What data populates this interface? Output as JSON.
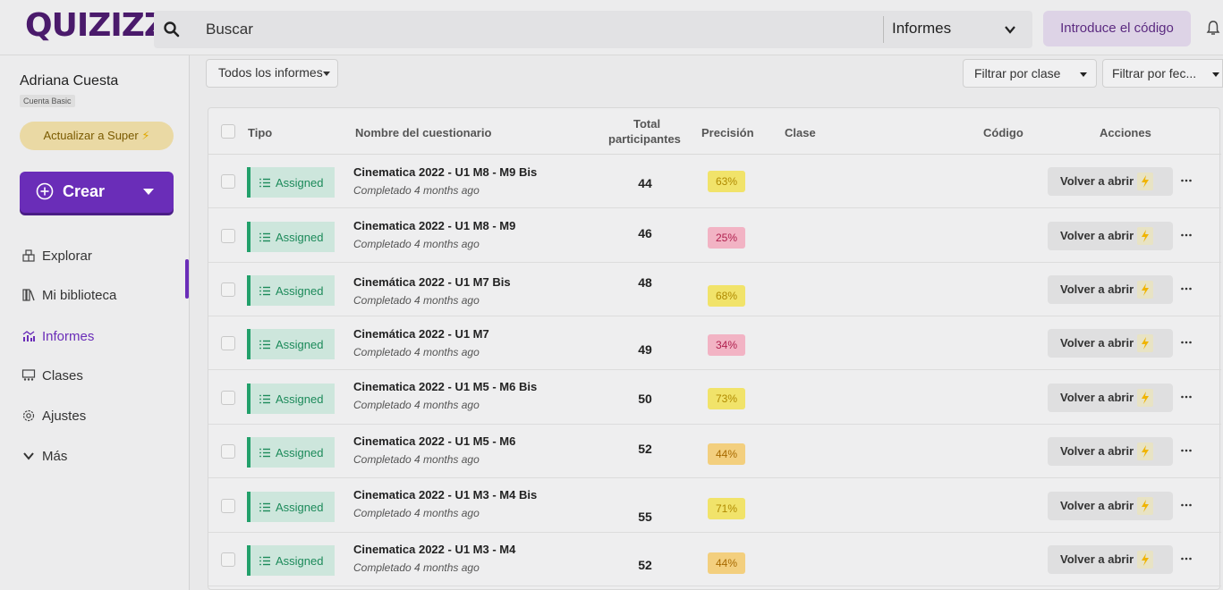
{
  "header": {
    "logo": "QUIZIZZ",
    "search_label": "Buscar",
    "reports_select": "Informes",
    "code_button": "Introduce el código"
  },
  "sidebar": {
    "user_name": "Adriana Cuesta",
    "account_type": "Cuenta Basic",
    "upgrade_label": "Actualizar a Super",
    "create_label": "Crear",
    "items": [
      {
        "label": "Explorar",
        "icon": "explore-icon"
      },
      {
        "label": "Mi biblioteca",
        "icon": "library-icon"
      },
      {
        "label": "Informes",
        "icon": "reports-icon",
        "active": true
      },
      {
        "label": "Clases",
        "icon": "classes-icon"
      },
      {
        "label": "Ajustes",
        "icon": "settings-icon"
      },
      {
        "label": "Más",
        "icon": "chevron-down-icon"
      }
    ]
  },
  "filters": {
    "all_reports": "Todos los informes",
    "by_class": "Filtrar por clase",
    "by_date": "Filtrar por fec..."
  },
  "table": {
    "headers": {
      "type": "Tipo",
      "name": "Nombre del cuestionario",
      "total_line1": "Total",
      "total_line2": "participantes",
      "accuracy": "Precisión",
      "class": "Clase",
      "code": "Código",
      "actions": "Acciones"
    },
    "rows": [
      {
        "type": "Assigned",
        "name": "Cinematica 2022 - U1 M8 - M9 Bis",
        "status": "Completado 4 months ago",
        "participants": "44",
        "accuracy": "63%",
        "level": "yellow"
      },
      {
        "type": "Assigned",
        "name": "Cinematica 2022 - U1 M8 - M9",
        "status": "Completado 4 months ago",
        "participants": "46",
        "accuracy": "25%",
        "level": "red"
      },
      {
        "type": "Assigned",
        "name": "Cinemática 2022 - U1 M7 Bis",
        "status": "Completado 4 months ago",
        "participants": "48",
        "accuracy": "68%",
        "level": "yellow"
      },
      {
        "type": "Assigned",
        "name": "Cinemática 2022 - U1 M7",
        "status": "Completado 4 months ago",
        "participants": "49",
        "accuracy": "34%",
        "level": "red"
      },
      {
        "type": "Assigned",
        "name": "Cinematica 2022 - U1 M5 - M6 Bis",
        "status": "Completado 4 months ago",
        "participants": "50",
        "accuracy": "73%",
        "level": "yellow"
      },
      {
        "type": "Assigned",
        "name": "Cinematica 2022 - U1 M5 - M6",
        "status": "Completado 4 months ago",
        "participants": "52",
        "accuracy": "44%",
        "level": "orange"
      },
      {
        "type": "Assigned",
        "name": "Cinematica 2022 - U1 M3 - M4 Bis",
        "status": "Completado 4 months ago",
        "participants": "55",
        "accuracy": "71%",
        "level": "yellow"
      },
      {
        "type": "Assigned",
        "name": "Cinematica 2022 - U1 M3 - M4",
        "status": "Completado 4 months ago",
        "participants": "52",
        "accuracy": "44%",
        "level": "orange"
      }
    ],
    "reopen_label": "Volver a abrir"
  },
  "colors": {
    "brand": "#6a2db8",
    "assigned_green": "#22a06b",
    "accuracy_yellow": "#f1e36a",
    "accuracy_orange": "#f3cf7e",
    "accuracy_red": "#f2b3c4"
  }
}
